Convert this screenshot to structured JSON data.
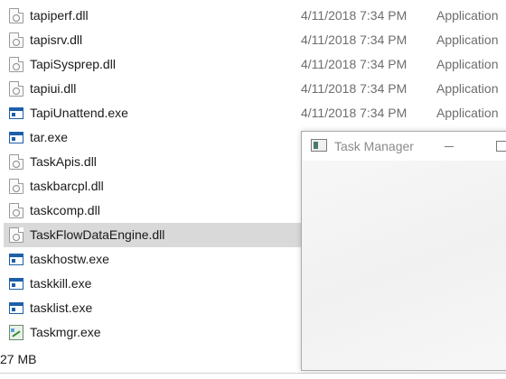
{
  "files": [
    {
      "name": "tapiperf.dll",
      "date": "4/11/2018 7:34 PM",
      "type": "Application",
      "icon": "dll-file-icon"
    },
    {
      "name": "tapisrv.dll",
      "date": "4/11/2018 7:34 PM",
      "type": "Application",
      "icon": "dll-file-icon"
    },
    {
      "name": "TapiSysprep.dll",
      "date": "4/11/2018 7:34 PM",
      "type": "Application",
      "icon": "dll-file-icon"
    },
    {
      "name": "tapiui.dll",
      "date": "4/11/2018 7:34 PM",
      "type": "Application",
      "icon": "dll-file-icon"
    },
    {
      "name": "TapiUnattend.exe",
      "date": "4/11/2018 7:34 PM",
      "type": "Application",
      "icon": "exe-file-icon"
    },
    {
      "name": "tar.exe",
      "date": "",
      "type": "",
      "icon": "exe-file-icon"
    },
    {
      "name": "TaskApis.dll",
      "date": "",
      "type": "",
      "icon": "dll-file-icon"
    },
    {
      "name": "taskbarcpl.dll",
      "date": "",
      "type": "",
      "icon": "dll-file-icon"
    },
    {
      "name": "taskcomp.dll",
      "date": "",
      "type": "",
      "icon": "dll-file-icon"
    },
    {
      "name": "TaskFlowDataEngine.dll",
      "date": "",
      "type": "",
      "icon": "dll-file-icon",
      "selected": true
    },
    {
      "name": "taskhostw.exe",
      "date": "",
      "type": "",
      "icon": "exe-file-icon"
    },
    {
      "name": "taskkill.exe",
      "date": "",
      "type": "",
      "icon": "exe-file-icon"
    },
    {
      "name": "tasklist.exe",
      "date": "",
      "type": "",
      "icon": "exe-file-icon"
    },
    {
      "name": "Taskmgr.exe",
      "date": "",
      "type": "",
      "icon": "task-manager-icon"
    }
  ],
  "status_bar": {
    "text": "27 MB"
  },
  "task_manager": {
    "title": "Task Manager"
  },
  "colors": {
    "selection": "#d9d9d9",
    "meta_text": "#6d6d6d",
    "title_text": "#8a8a8a"
  }
}
